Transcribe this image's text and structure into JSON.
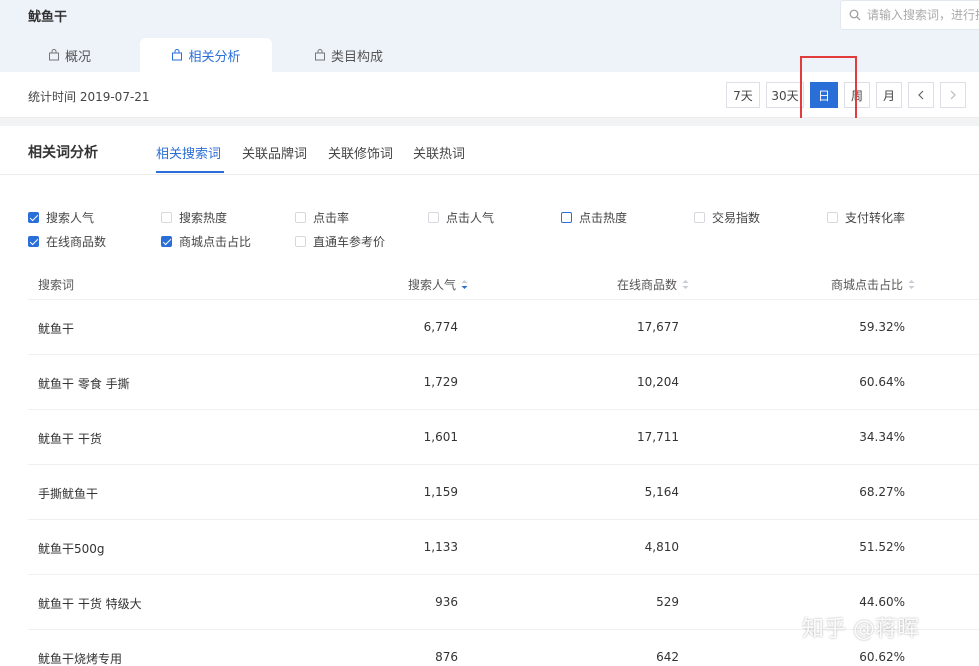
{
  "header": {
    "keyword": "鱿鱼干",
    "search_placeholder": "请输入搜索词，进行搜索"
  },
  "tabs": [
    {
      "label": "概况",
      "active": false
    },
    {
      "label": "相关分析",
      "active": true
    },
    {
      "label": "类目构成",
      "active": false
    }
  ],
  "datebar": {
    "stat_time": "统计时间 2019-07-21",
    "periods": [
      "7天",
      "30天",
      "日",
      "周",
      "月"
    ],
    "active_period": "日"
  },
  "section": {
    "title": "相关词分析",
    "subtabs": [
      "相关搜索词",
      "关联品牌词",
      "关联修饰词",
      "关联热词"
    ],
    "active_subtab": "相关搜索词"
  },
  "metrics": [
    {
      "label": "搜索人气",
      "checked": true
    },
    {
      "label": "搜索热度",
      "checked": false
    },
    {
      "label": "点击率",
      "checked": false
    },
    {
      "label": "点击人气",
      "checked": false
    },
    {
      "label": "点击热度",
      "checked": false
    },
    {
      "label": "交易指数",
      "checked": false
    },
    {
      "label": "支付转化率",
      "checked": false
    },
    {
      "label": "在线商品数",
      "checked": true
    },
    {
      "label": "商城点击占比",
      "checked": true
    },
    {
      "label": "直通车参考价",
      "checked": false
    }
  ],
  "table": {
    "columns": [
      "搜索词",
      "搜索人气",
      "在线商品数",
      "商城点击占比"
    ],
    "rows": [
      [
        "鱿鱼干",
        "6,774",
        "17,677",
        "59.32%"
      ],
      [
        "鱿鱼干 零食 手撕",
        "1,729",
        "10,204",
        "60.64%"
      ],
      [
        "鱿鱼干 干货",
        "1,601",
        "17,711",
        "34.34%"
      ],
      [
        "手撕鱿鱼干",
        "1,159",
        "5,164",
        "68.27%"
      ],
      [
        "鱿鱼干500g",
        "1,133",
        "4,810",
        "51.52%"
      ],
      [
        "鱿鱼干 干货 特级大",
        "936",
        "529",
        "44.60%"
      ],
      [
        "鱿鱼干烧烤专用",
        "876",
        "642",
        "60.62%"
      ]
    ]
  },
  "colors": {
    "accent": "#2a6ed8",
    "highlight": "#e23b3b"
  },
  "watermark": "知乎 @蒋晖"
}
